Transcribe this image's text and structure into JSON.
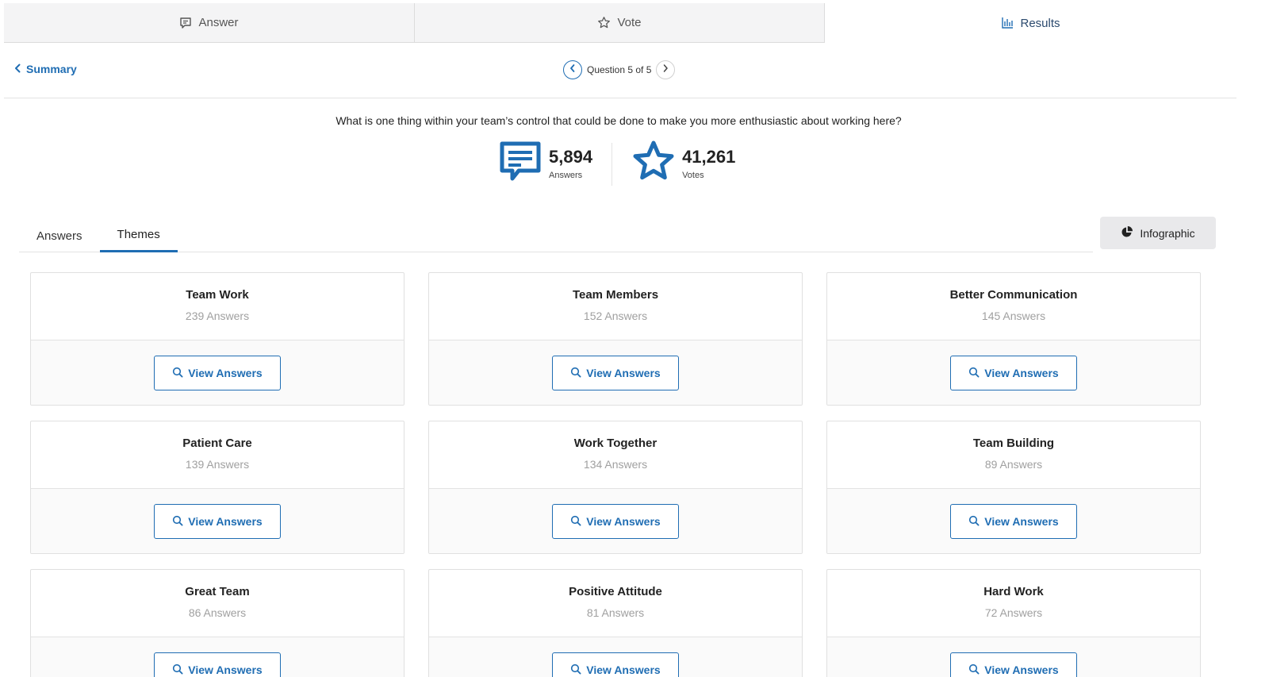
{
  "topnav": {
    "tabs": [
      {
        "label": "Answer",
        "icon": "message-icon"
      },
      {
        "label": "Vote",
        "icon": "star-icon"
      },
      {
        "label": "Results",
        "icon": "bar-chart-icon"
      }
    ],
    "active_tab": "Results"
  },
  "header": {
    "back_label": "Summary",
    "question_position": "Question 5 of 5"
  },
  "question": {
    "text": "What is one thing within your team’s control that could be done to make you more enthusiastic about working here?"
  },
  "stats": {
    "answers": {
      "value": "5,894",
      "label": "Answers"
    },
    "votes": {
      "value": "41,261",
      "label": "Votes"
    }
  },
  "subtabs": [
    {
      "label": "Answers"
    },
    {
      "label": "Themes"
    }
  ],
  "active_subtab": "Themes",
  "infographic_label": "Infographic",
  "colors": {
    "accent": "#1f6db3",
    "muted_text": "#a0a0a0"
  },
  "view_answers_label": "View Answers",
  "themes": [
    {
      "title": "Team Work",
      "count": "239 Answers"
    },
    {
      "title": "Team Members",
      "count": "152 Answers"
    },
    {
      "title": "Better Communication",
      "count": "145 Answers"
    },
    {
      "title": "Patient Care",
      "count": "139 Answers"
    },
    {
      "title": "Work Together",
      "count": "134 Answers"
    },
    {
      "title": "Team Building",
      "count": "89 Answers"
    },
    {
      "title": "Great Team",
      "count": "86 Answers"
    },
    {
      "title": "Positive Attitude",
      "count": "81 Answers"
    },
    {
      "title": "Hard Work",
      "count": "72 Answers"
    }
  ]
}
